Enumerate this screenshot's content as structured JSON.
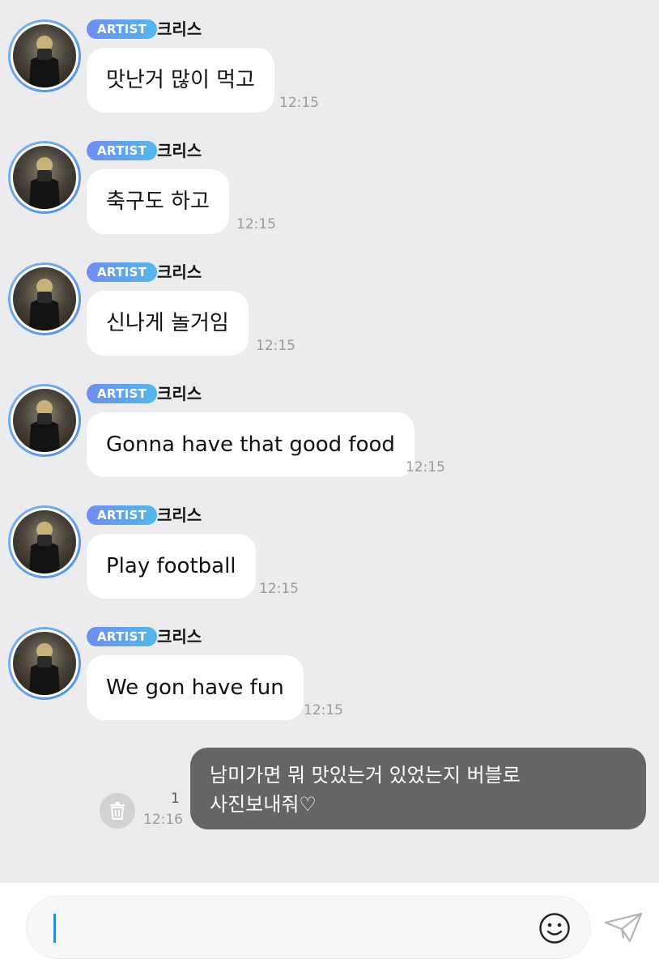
{
  "messages": [
    {
      "badge": "ARTIST",
      "sender": "크리스",
      "text": "맛난거 많이 먹고",
      "time": "12:15"
    },
    {
      "badge": "ARTIST",
      "sender": "크리스",
      "text": "축구도 하고",
      "time": "12:15"
    },
    {
      "badge": "ARTIST",
      "sender": "크리스",
      "text": "신나게 놀거임",
      "time": "12:15"
    },
    {
      "badge": "ARTIST",
      "sender": "크리스",
      "text": "Gonna have that good food",
      "time": "12:15"
    },
    {
      "badge": "ARTIST",
      "sender": "크리스",
      "text": "Play football",
      "time": "12:15"
    },
    {
      "badge": "ARTIST",
      "sender": "크리스",
      "text": "We gon have fun",
      "time": "12:15"
    }
  ],
  "outgoing": {
    "line1": "남미가면 뭐 맛있는거 있었는지 버블로",
    "line2": "사진보내줘♡",
    "unread_count": "1",
    "time": "12:16"
  },
  "composer": {
    "placeholder": ""
  },
  "icons": {
    "delete": "trash-icon",
    "emoji": "smiley-icon",
    "send": "paper-plane-icon"
  },
  "colors": {
    "background": "#ececee",
    "badge_start": "#6f8df2",
    "badge_end": "#52b8ea",
    "outgoing_bubble": "#656565",
    "caret": "#2b8fd8"
  }
}
